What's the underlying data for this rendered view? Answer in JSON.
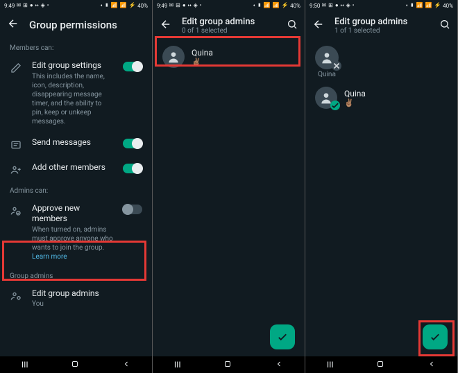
{
  "statusbar": {
    "time1": "9:49",
    "time2": "9:49",
    "time3": "9:50",
    "icons_left": "✉ ⊞ ● ⬪⬪ ◈ •",
    "icons_right": "⬪ ▮ 📶 📶 ⚡",
    "battery": "40%"
  },
  "screen1": {
    "title": "Group permissions",
    "members_label": "Members can:",
    "edit_settings": {
      "title": "Edit group settings",
      "desc": "This includes the name, icon, description, disappearing message timer, and the ability to pin, keep or unkeep messages."
    },
    "send_messages": "Send messages",
    "add_members": "Add other members",
    "admins_label": "Admins can:",
    "approve": {
      "title": "Approve new members",
      "desc": "When turned on, admins must approve anyone who wants to join the group.",
      "link": "Learn more"
    },
    "group_admins_label": "Group admins",
    "edit_admins": {
      "title": "Edit group admins",
      "sub": "You"
    }
  },
  "screen2": {
    "title": "Edit group admins",
    "subtitle": "0 of 1 selected",
    "contact": {
      "name": "Quina",
      "status": "✌🏽"
    }
  },
  "screen3": {
    "title": "Edit group admins",
    "subtitle": "1 of 1 selected",
    "chip_name": "Quina",
    "contact": {
      "name": "Quina",
      "status": "✌🏽"
    }
  }
}
